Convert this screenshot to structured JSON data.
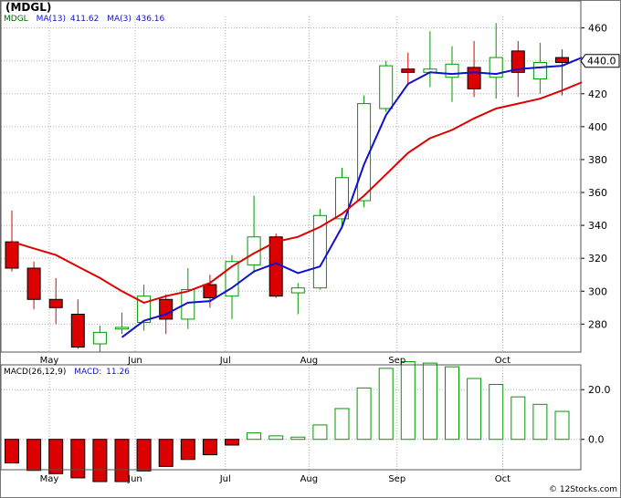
{
  "header": {
    "title": "(MDGL)"
  },
  "legend": {
    "symbol": "MDGL",
    "ma13": "MA(13)",
    "ma13_value": "411.62",
    "ma3": "MA(3)",
    "ma3_value": "436.16"
  },
  "macd_legend": {
    "label": "MACD(26,12,9)",
    "macd": "MACD:",
    "macd_value": "11.26"
  },
  "footer": {
    "watermark": "© 12Stocks.com"
  },
  "colors": {
    "up": "#009900",
    "down": "#dd0000",
    "ma13": "#1010cc",
    "ma3": "#dd0000",
    "grid": "#b0b0b0"
  },
  "chart_data": [
    {
      "type": "candlestick",
      "title": "(MDGL)",
      "x_tick_labels": [
        "May",
        "Jun",
        "Jul",
        "Aug",
        "Sep",
        "Oct"
      ],
      "x_tick_weeks": [
        1.7,
        5.6,
        9.7,
        13.5,
        17.5,
        22.3
      ],
      "y_ticks": [
        280,
        300,
        320,
        340,
        360,
        380,
        400,
        420,
        440,
        460
      ],
      "ylim": [
        263,
        467
      ],
      "last_price": "440.0",
      "grid": true,
      "weeks": [
        {
          "o": 330,
          "h": 349,
          "l": 312,
          "c": 314
        },
        {
          "o": 314,
          "h": 318,
          "l": 289,
          "c": 295
        },
        {
          "o": 295,
          "h": 308,
          "l": 280,
          "c": 290
        },
        {
          "o": 286,
          "h": 295,
          "l": 265,
          "c": 266
        },
        {
          "o": 268,
          "h": 279,
          "l": 263,
          "c": 275
        },
        {
          "o": 277,
          "h": 287,
          "l": 274,
          "c": 278
        },
        {
          "o": 281,
          "h": 304,
          "l": 276,
          "c": 297
        },
        {
          "o": 295,
          "h": 298,
          "l": 274,
          "c": 283
        },
        {
          "o": 283,
          "h": 314,
          "l": 277,
          "c": 301
        },
        {
          "o": 304,
          "h": 310,
          "l": 290,
          "c": 296
        },
        {
          "o": 297,
          "h": 322,
          "l": 283,
          "c": 318
        },
        {
          "o": 316,
          "h": 358,
          "l": 311,
          "c": 333
        },
        {
          "o": 333,
          "h": 335,
          "l": 296,
          "c": 297
        },
        {
          "o": 299,
          "h": 305,
          "l": 286,
          "c": 302
        },
        {
          "o": 302,
          "h": 350,
          "l": 301,
          "c": 346
        },
        {
          "o": 344,
          "h": 375,
          "l": 340,
          "c": 369
        },
        {
          "o": 355,
          "h": 419,
          "l": 351,
          "c": 414
        },
        {
          "o": 411,
          "h": 440,
          "l": 409,
          "c": 437
        },
        {
          "o": 435,
          "h": 445,
          "l": 425,
          "c": 433
        },
        {
          "o": 433,
          "h": 458,
          "l": 424,
          "c": 435
        },
        {
          "o": 430,
          "h": 449,
          "l": 415,
          "c": 438
        },
        {
          "o": 436,
          "h": 452,
          "l": 418,
          "c": 423
        },
        {
          "o": 430,
          "h": 463,
          "l": 417,
          "c": 442
        },
        {
          "o": 446,
          "h": 452,
          "l": 418,
          "c": 433
        },
        {
          "o": 429,
          "h": 451,
          "l": 420,
          "c": 439
        },
        {
          "o": 442,
          "h": 447,
          "l": 419,
          "c": 439
        }
      ],
      "series": [
        {
          "name": "MA(13)",
          "color": "#1010cc",
          "points": [
            [
              5,
              272
            ],
            [
              6,
              282
            ],
            [
              7,
              286
            ],
            [
              8,
              293
            ],
            [
              9,
              294
            ],
            [
              10,
              302
            ],
            [
              11,
              312
            ],
            [
              12,
              317
            ],
            [
              13,
              311
            ],
            [
              14,
              315
            ],
            [
              15,
              339
            ],
            [
              16,
              377
            ],
            [
              17,
              407
            ],
            [
              18,
              426
            ],
            [
              19,
              433
            ],
            [
              20,
              432
            ],
            [
              21,
              433
            ],
            [
              22,
              432
            ],
            [
              23,
              435
            ],
            [
              24,
              436
            ],
            [
              25,
              437
            ],
            [
              25.9,
              442
            ]
          ]
        },
        {
          "name": "MA(3)",
          "color": "#dd0000",
          "points": [
            [
              0,
              330
            ],
            [
              1,
              326
            ],
            [
              2,
              322
            ],
            [
              3,
              315
            ],
            [
              4,
              308
            ],
            [
              5,
              300
            ],
            [
              6,
              293
            ],
            [
              7,
              297
            ],
            [
              8,
              300
            ],
            [
              9,
              305
            ],
            [
              10,
              315
            ],
            [
              11,
              323
            ],
            [
              12,
              330
            ],
            [
              13,
              333
            ],
            [
              14,
              339
            ],
            [
              15,
              347
            ],
            [
              16,
              358
            ],
            [
              17,
              371
            ],
            [
              18,
              384
            ],
            [
              19,
              393
            ],
            [
              20,
              398
            ],
            [
              21,
              405
            ],
            [
              22,
              411
            ],
            [
              23,
              414
            ],
            [
              24,
              417
            ],
            [
              25,
              422
            ],
            [
              25.9,
              427
            ]
          ]
        }
      ]
    },
    {
      "type": "bar",
      "title": "MACD(26,12,9)",
      "y_ticks": [
        0.0,
        20.0
      ],
      "ylim": [
        -17,
        30
      ],
      "values": [
        -9.5,
        -12.5,
        -13.8,
        -15.5,
        -17.0,
        -17.0,
        -12.7,
        -10.9,
        -8.1,
        -6.2,
        -2.3,
        2.6,
        1.4,
        0.9,
        5.8,
        12.4,
        20.7,
        28.6,
        31.3,
        30.7,
        29.2,
        24.5,
        22.1,
        17.1,
        14.1,
        11.26
      ]
    }
  ]
}
